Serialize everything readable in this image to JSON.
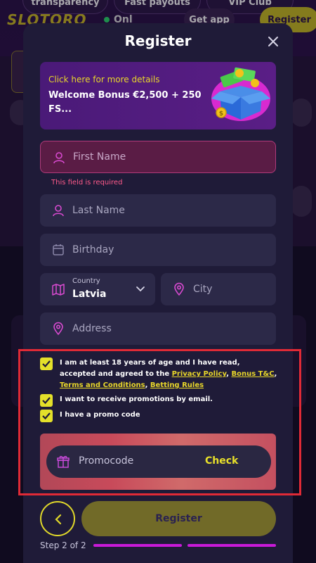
{
  "background": {
    "logo": "SLOTORO",
    "top_pills": [
      "transparency",
      "Fast payouts",
      "VIP Club"
    ],
    "online_text": "Onl",
    "get_app": "Get app",
    "register": "Register"
  },
  "modal": {
    "title": "Register",
    "banner": {
      "link": "Click here for more details",
      "text": "Welcome Bonus €2,500 + 250 FS..."
    },
    "fields": {
      "first_name": "First Name",
      "first_name_error": "This field is required",
      "last_name": "Last Name",
      "birthday": "Birthday",
      "country_caption": "Country",
      "country_value": "Latvia",
      "city": "City",
      "address": "Address"
    },
    "consent": {
      "age_text": "I am at least 18 years of age and I have read, accepted and agreed to the",
      "privacy": "Privacy Policy",
      "bonus": "Bonus T&C",
      "terms": "Terms and Conditions",
      "betting": "Betting Rules",
      "promotions": "I want to receive promotions by email.",
      "promo_code": "I have a promo code"
    },
    "promocode": {
      "placeholder": "Promocode",
      "check": "Check"
    },
    "register_button": "Register",
    "step": "Step 2 of 2"
  },
  "colors": {
    "accent": "#e8e02a",
    "error": "#ff5a8a",
    "progress": "#c81ad8",
    "highlight": "#e02a36"
  }
}
